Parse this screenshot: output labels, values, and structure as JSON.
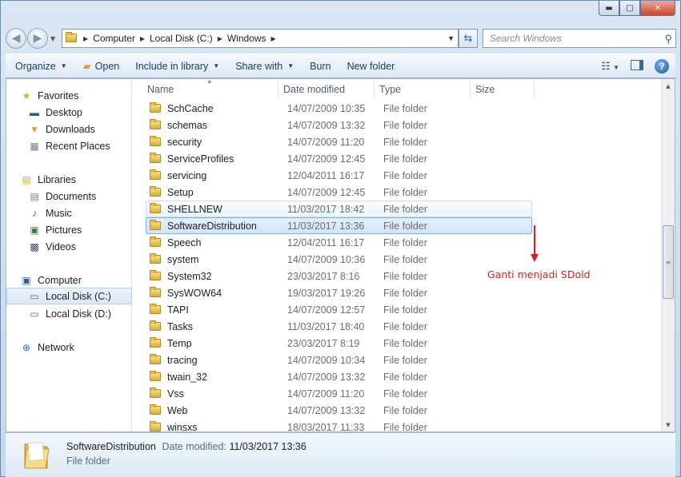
{
  "caption": {
    "minimize": "▬",
    "maximize": "□",
    "close": "✕"
  },
  "address": {
    "segments": [
      "Computer",
      "Local Disk (C:)",
      "Windows"
    ]
  },
  "search": {
    "placeholder": "Search Windows"
  },
  "toolbar": {
    "organize": "Organize",
    "open": "Open",
    "include_in_library": "Include in library",
    "share_with": "Share with",
    "burn": "Burn",
    "new_folder": "New folder"
  },
  "sidebar": {
    "favorites": "Favorites",
    "desktop": "Desktop",
    "downloads": "Downloads",
    "recent_places": "Recent Places",
    "libraries": "Libraries",
    "documents": "Documents",
    "music": "Music",
    "pictures": "Pictures",
    "videos": "Videos",
    "computer": "Computer",
    "local_disk_c": "Local Disk (C:)",
    "local_disk_d": "Local Disk (D:)",
    "network": "Network"
  },
  "columns": {
    "name": "Name",
    "date_modified": "Date modified",
    "type": "Type",
    "size": "Size"
  },
  "files": [
    {
      "name": "SchCache",
      "date": "14/07/2009 10:35",
      "type": "File folder"
    },
    {
      "name": "schemas",
      "date": "14/07/2009 13:32",
      "type": "File folder"
    },
    {
      "name": "security",
      "date": "14/07/2009 11:20",
      "type": "File folder"
    },
    {
      "name": "ServiceProfiles",
      "date": "14/07/2009 12:45",
      "type": "File folder"
    },
    {
      "name": "servicing",
      "date": "12/04/2011 16:17",
      "type": "File folder"
    },
    {
      "name": "Setup",
      "date": "14/07/2009 12:45",
      "type": "File folder"
    },
    {
      "name": "SHELLNEW",
      "date": "11/03/2017 18:42",
      "type": "File folder"
    },
    {
      "name": "SoftwareDistribution",
      "date": "11/03/2017 13:36",
      "type": "File folder"
    },
    {
      "name": "Speech",
      "date": "12/04/2011 16:17",
      "type": "File folder"
    },
    {
      "name": "system",
      "date": "14/07/2009 10:36",
      "type": "File folder"
    },
    {
      "name": "System32",
      "date": "23/03/2017 8:16",
      "type": "File folder"
    },
    {
      "name": "SysWOW64",
      "date": "19/03/2017 19:26",
      "type": "File folder"
    },
    {
      "name": "TAPI",
      "date": "14/07/2009 12:57",
      "type": "File folder"
    },
    {
      "name": "Tasks",
      "date": "11/03/2017 18:40",
      "type": "File folder"
    },
    {
      "name": "Temp",
      "date": "23/03/2017 8:19",
      "type": "File folder"
    },
    {
      "name": "tracing",
      "date": "14/07/2009 10:34",
      "type": "File folder"
    },
    {
      "name": "twain_32",
      "date": "14/07/2009 13:32",
      "type": "File folder"
    },
    {
      "name": "Vss",
      "date": "14/07/2009 11:20",
      "type": "File folder"
    },
    {
      "name": "Web",
      "date": "14/07/2009 13:32",
      "type": "File folder"
    },
    {
      "name": "winsxs",
      "date": "18/03/2017 11:33",
      "type": "File folder"
    }
  ],
  "annotation": {
    "text": "Ganti menjadi SDold",
    "color": "#e11b1b"
  },
  "details": {
    "name": "SoftwareDistribution",
    "date_label": "Date modified:",
    "date_value": "11/03/2017 13:36",
    "type": "File folder"
  }
}
